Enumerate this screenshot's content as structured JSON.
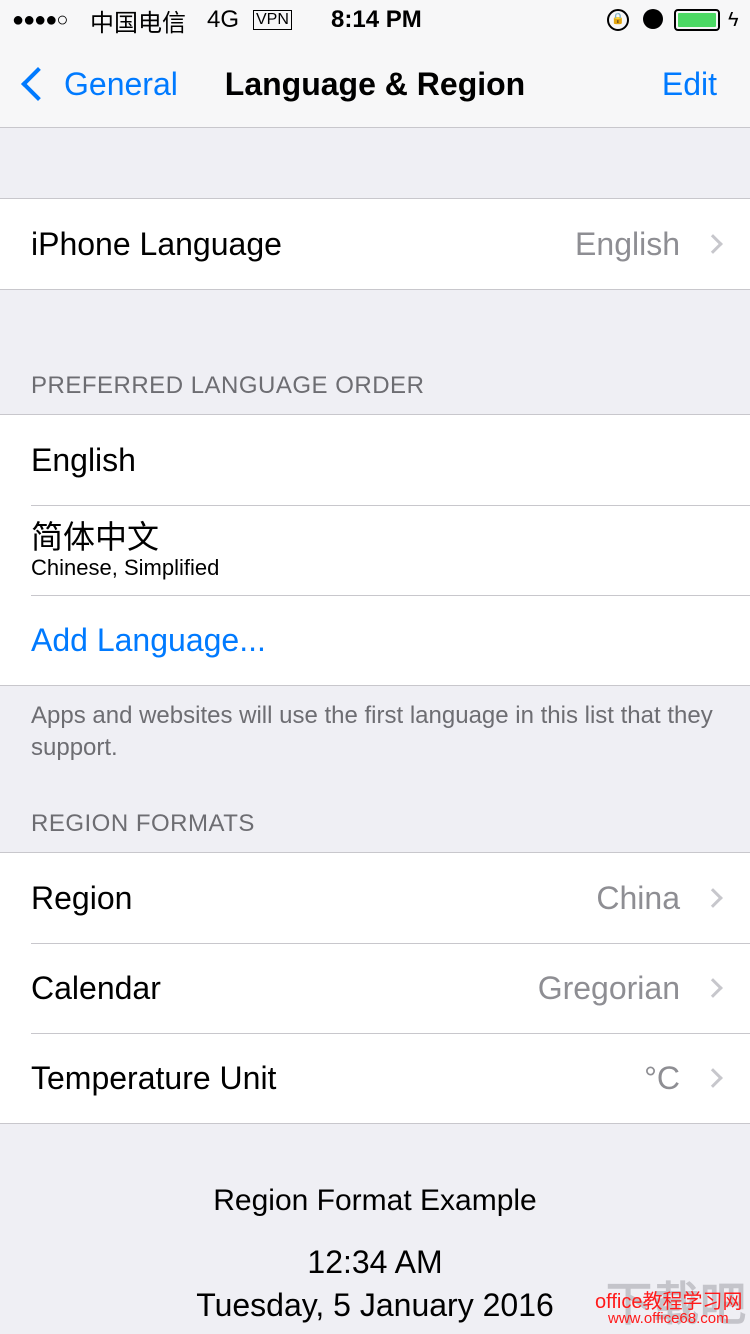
{
  "status": {
    "signal": "●●●●○",
    "carrier": "中国电信",
    "network": "4G",
    "vpn": "VPN",
    "time": "8:14 PM",
    "battery_level": 1.0,
    "battery_color": "#4cd964"
  },
  "nav": {
    "back_label": "General",
    "title": "Language & Region",
    "edit_label": "Edit",
    "accent": "#007aff"
  },
  "iphone_language": {
    "label": "iPhone Language",
    "value": "English"
  },
  "preferred": {
    "header": "PREFERRED LANGUAGE ORDER",
    "items": [
      {
        "label": "English"
      },
      {
        "label": "简体中文",
        "sublabel": "Chinese, Simplified"
      }
    ],
    "add_label": "Add Language...",
    "footer": "Apps and websites will use the first language in this list that they support."
  },
  "region": {
    "header": "REGION FORMATS",
    "rows": [
      {
        "label": "Region",
        "value": "China"
      },
      {
        "label": "Calendar",
        "value": "Gregorian"
      },
      {
        "label": "Temperature Unit",
        "value": "°C"
      }
    ]
  },
  "example": {
    "title": "Region Format Example",
    "time": "12:34 AM",
    "date": "Tuesday, 5 January 2016"
  },
  "watermark": {
    "logo": "下载吧",
    "line1": "office教程学习网",
    "line2": "www.office68.com"
  }
}
